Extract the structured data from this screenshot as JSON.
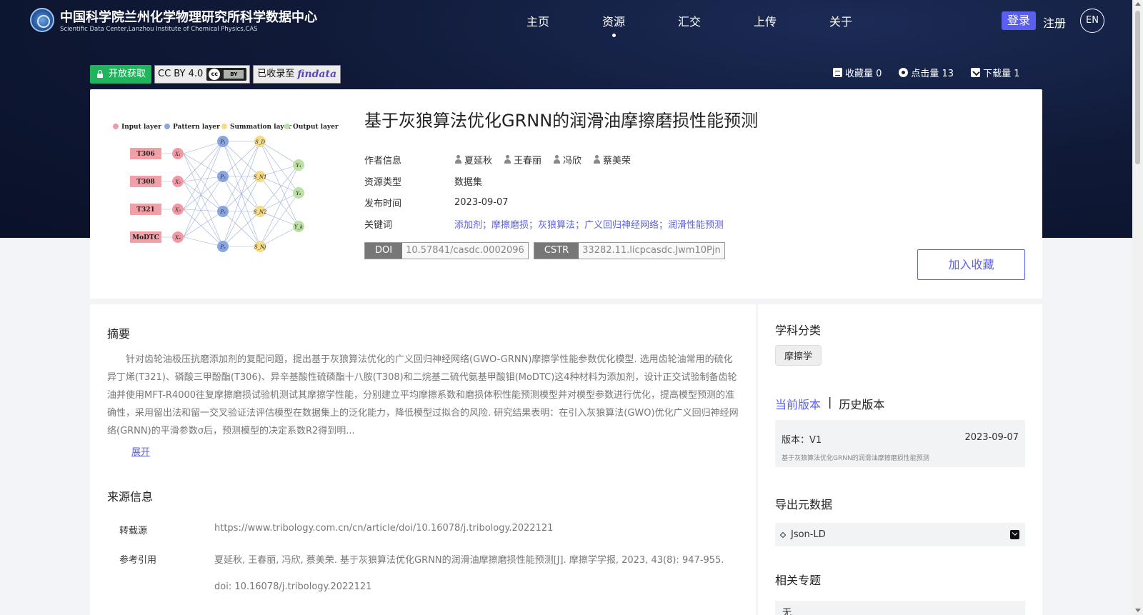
{
  "header": {
    "site_title": "中国科学院兰州化学物理研究所科学数据中心",
    "site_subtitle": "Scientific Data Center,Lanzhou Institute of Chemical Physics,CAS",
    "nav": [
      "主页",
      "资源",
      "汇交",
      "上传",
      "关于"
    ],
    "active_nav": "资源",
    "login": "登录",
    "register": "注册",
    "lang": "EN"
  },
  "badges": {
    "open_access": "开放获取",
    "license": "CC BY 4.0",
    "indexed_prefix": "已收录至",
    "indexed_brand": "findata"
  },
  "stats": {
    "favorites": "收藏量 0",
    "views": "点击量 13",
    "downloads": "下载量 1"
  },
  "dataset": {
    "title": "基于灰狼算法优化GRNN的润滑油摩擦磨损性能预测",
    "labels": {
      "authors": "作者信息",
      "type": "资源类型",
      "date": "发布时间",
      "keywords": "关键词"
    },
    "authors": [
      "夏延秋",
      "王春丽",
      "冯欣",
      "蔡美荣"
    ],
    "type": "数据集",
    "date": "2023-09-07",
    "keywords": "添加剂；摩擦磨损；灰狼算法；广义回归神经网络；润滑性能预测",
    "doi_label": "DOI",
    "doi": "10.57841/casdc.0002096",
    "cstr_label": "CSTR",
    "cstr": "33282.11.licpcasdc.Jwm10Pjn",
    "add_favorite": "加入收藏"
  },
  "figure": {
    "legend": [
      "Input layer",
      "Pattern layer",
      "Summation layer",
      "Output layer"
    ],
    "inputs": [
      "T306",
      "T308",
      "T321",
      "MoDTC"
    ],
    "colors": {
      "input": "#f19aa5",
      "pattern": "#8aa6e0",
      "summation": "#f6dc8a",
      "output": "#bde0a6",
      "input_box": "#f2a0a8"
    }
  },
  "abstract": {
    "title": "摘要",
    "text": "针对齿轮油极压抗磨添加剂的复配问题，提出基于灰狼算法优化的广义回归神经网络(GWO-GRNN)摩擦学性能参数优化模型. 选用齿轮油常用的硫化异丁烯(T321)、磷酸三甲酚酯(T306)、异辛基酸性硫磷酯十八胺(T308)和二烷基二硫代氨基甲酸钼(MoDTC)这4种材料为添加剂，设计正交试验制备齿轮油并使用MFT-R4000往复摩擦磨损试验机测试其摩擦学性能，分别建立平均摩擦系数和磨损体积性能预测模型并对模型参数进行优化，提高模型预测的准确性，采用留出法和留一交叉验证法评估模型在数据集上的泛化能力，降低模型过拟合的风险. 研究结果表明：在引入灰狼算法(GWO)优化广义回归神经网络(GRNN)的平滑参数σ后，预测模型的决定系数R2得到明...",
    "expand": "展开"
  },
  "source": {
    "title": "来源信息",
    "repost_label": "转载源",
    "repost_url": "https://www.tribology.com.cn/cn/article/doi/10.16078/j.tribology.2022121",
    "cite_label": "参考引用",
    "cite_text": "夏延秋, 王春丽, 冯欣, 蔡美荣. 基于灰狼算法优化GRNN的润滑油摩擦磨损性能预测[J]. 摩擦学学报, 2023, 43(8): 947-955.",
    "cite_doi": "doi: 10.16078/j.tribology.2022121"
  },
  "sidebar": {
    "subject_title": "学科分类",
    "subject_tag": "摩擦学",
    "version_current": "当前版本",
    "version_sep": "|",
    "version_history": "历史版本",
    "version_label": "版本：V1",
    "version_date": "2023-09-07",
    "version_desc": "基于灰狼算法优化GRNN的润滑油摩擦磨损性能预测",
    "export_title": "导出元数据",
    "export_format": "Json-LD",
    "topics_title": "相关专题",
    "topics_value": "无"
  }
}
